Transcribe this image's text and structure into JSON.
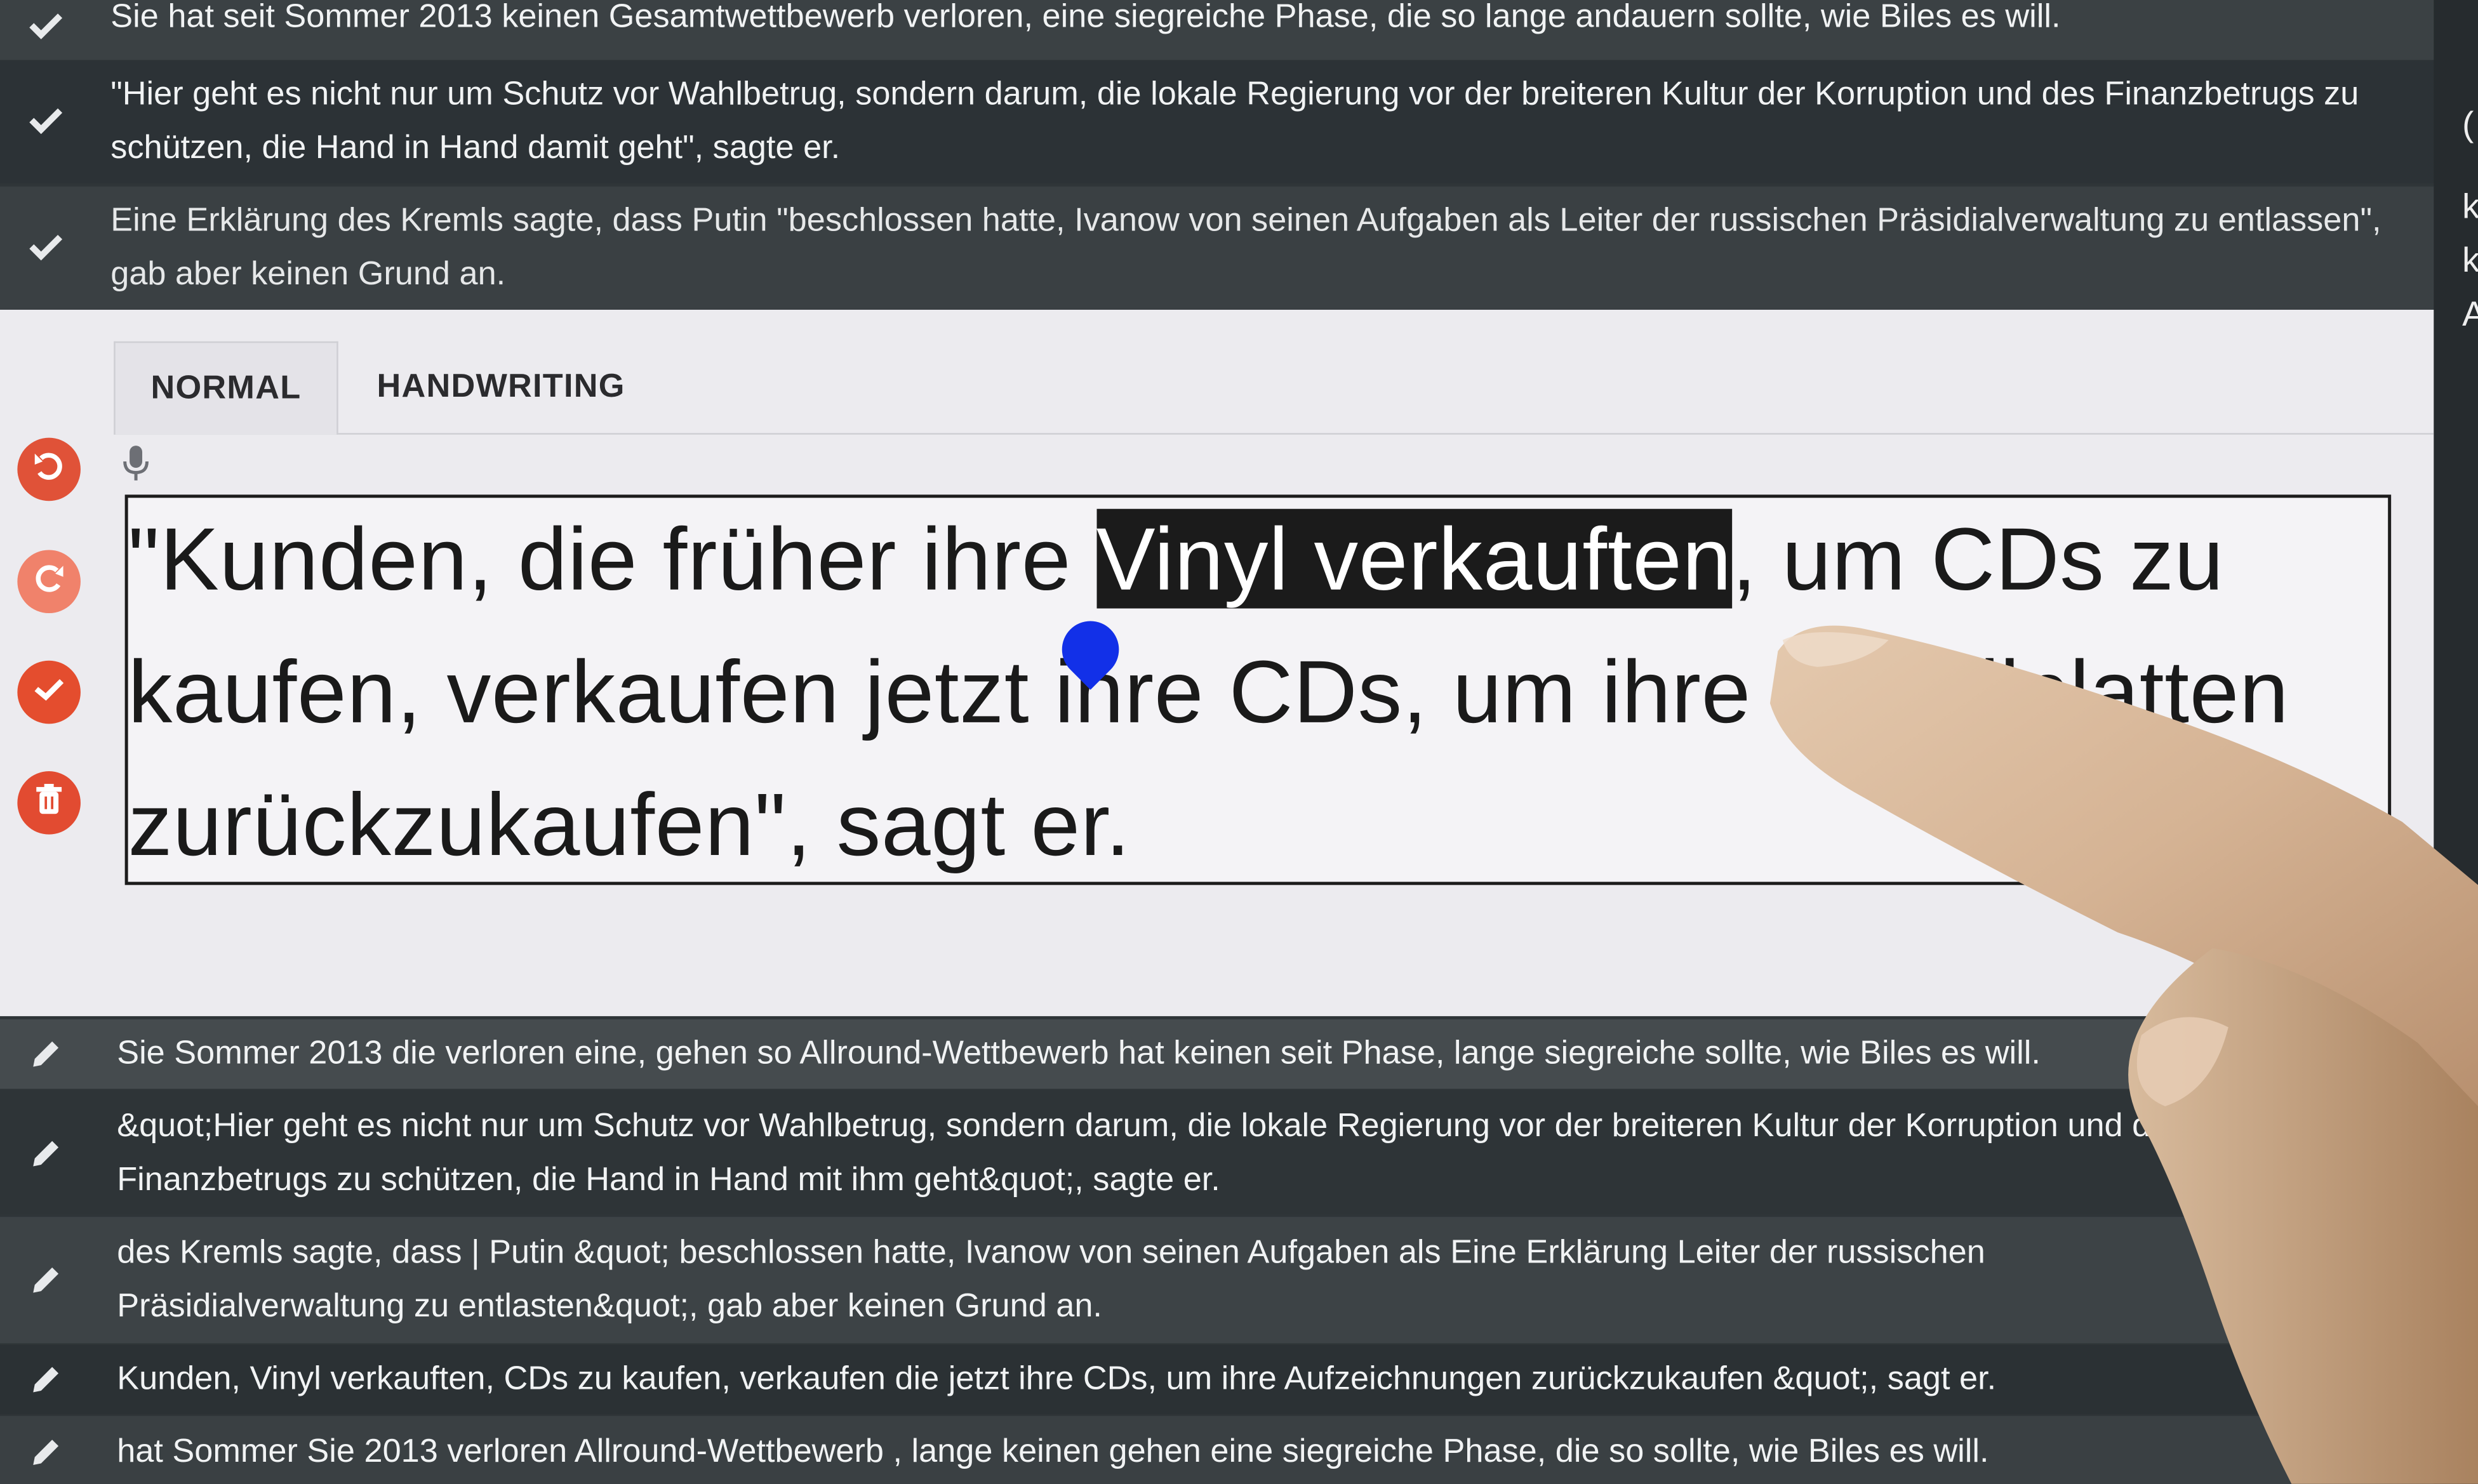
{
  "top_list": [
    {
      "status": "check-icon",
      "text": "Sie hat seit Sommer 2013 keinen Gesamtwettbewerb verloren, eine siegreiche Phase, die so lange andauern sollte, wie Biles es will."
    },
    {
      "status": "check-icon",
      "text": "\"Hier geht es nicht nur um Schutz vor Wahlbetrug, sondern darum, die lokale Regierung vor der breiteren Kultur der Korruption und des Finanzbetrugs zu schützen, die Hand in Hand damit geht\", sagte er."
    },
    {
      "status": "check-icon",
      "text": "Eine Erklärung des Kremls sagte, dass Putin \"beschlossen hatte, Ivanow von seinen Aufgaben als Leiter der russischen Präsidialverwaltung zu entlassen\", gab aber keinen Grund an."
    }
  ],
  "editor": {
    "tabs": [
      "NORMAL",
      "HANDWRITING"
    ],
    "active_tab": "NORMAL",
    "text_line1_before": "\"Kunden, die früher ihre ",
    "text_selected": "Vinyl verkauften",
    "text_line1_after": ", um CDs zu",
    "text_line2": "kaufen, verkaufen jetzt ihre CDs, um ihre Schallplatten",
    "text_line3": "zurückzukaufen\", sagt er."
  },
  "side_buttons": [
    "undo-icon",
    "redo-icon",
    "check-icon",
    "trash-icon"
  ],
  "bottom_list": [
    {
      "status": "pencil-icon",
      "text": "Sie Sommer 2013 die verloren eine, gehen so Allround-Wettbewerb hat keinen seit Phase, lange siegreiche sollte, wie Biles es will."
    },
    {
      "status": "pencil-icon",
      "text": "&quot;Hier geht es nicht nur um Schutz vor Wahlbetrug, sondern darum, die lokale Regierung vor der breiteren Kultur der Korruption und des Finanzbetrugs zu schützen, die Hand in Hand mit ihm geht&quot;, sagte er."
    },
    {
      "status": "pencil-icon",
      "text": "des Kremls sagte, dass | Putin &quot; beschlossen hatte, Ivanow von seinen Aufgaben als Eine Erklärung Leiter der russischen Präsidialverwaltung zu entlasten&quot;, gab aber keinen Grund an."
    },
    {
      "status": "pencil-icon",
      "text": "Kunden, Vinyl verkauften, CDs zu kaufen, verkaufen die jetzt ihre CDs, um ihre Aufzeichnungen zurückzukaufen &quot;, sagt er."
    },
    {
      "status": "pencil-icon",
      "text": "hat Sommer Sie 2013 verloren Allround-Wettbewerb , lange keinen gehen eine siegreiche Phase, die so sollte, wie Biles es will."
    }
  ],
  "right_fragments": [
    "(",
    "k",
    "k",
    "A"
  ],
  "colors": {
    "accent": "#e44d2e",
    "selection": "#1b1b1b",
    "cursor_handle": "#1230e8"
  }
}
